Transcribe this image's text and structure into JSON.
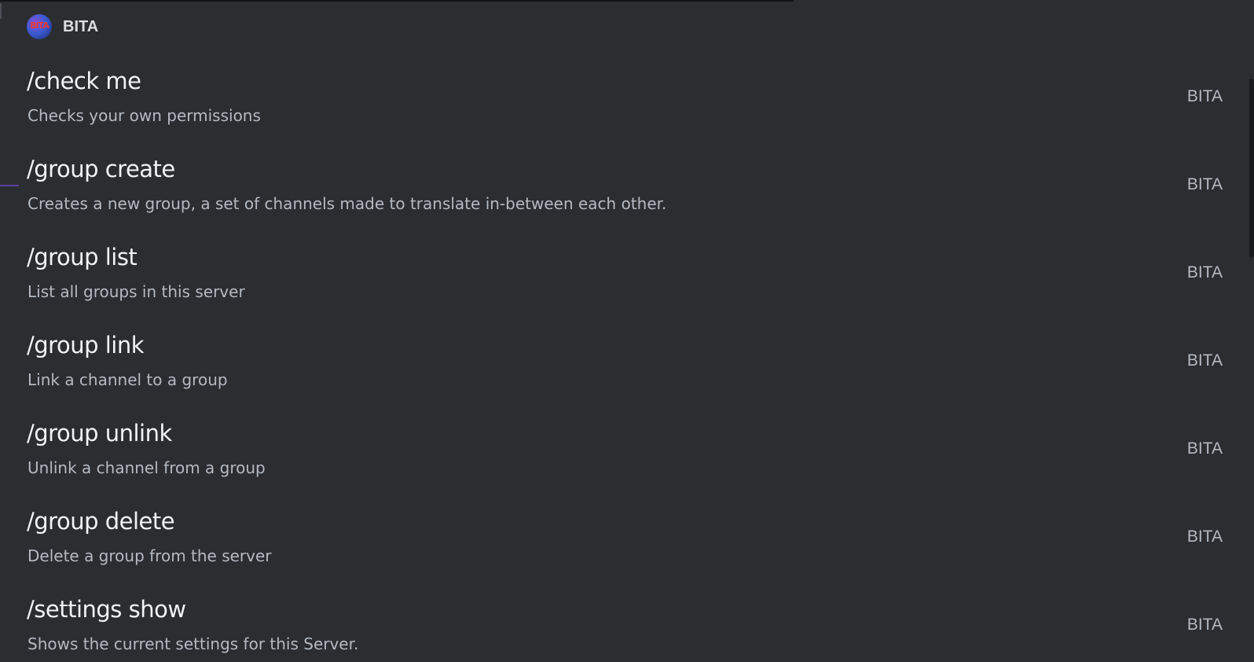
{
  "header": {
    "avatar_text": "BITA",
    "title": "BITA"
  },
  "commands": [
    {
      "name": "/check me",
      "description": "Checks your own permissions",
      "source": "BITA"
    },
    {
      "name": "/group create",
      "description": "Creates a new group, a set of channels made to translate in-between each other.",
      "source": "BITA"
    },
    {
      "name": "/group list",
      "description": "List all groups in this server",
      "source": "BITA"
    },
    {
      "name": "/group link",
      "description": "Link a channel to a group",
      "source": "BITA"
    },
    {
      "name": "/group unlink",
      "description": "Unlink a channel from a group",
      "source": "BITA"
    },
    {
      "name": "/group delete",
      "description": "Delete a group from the server",
      "source": "BITA"
    },
    {
      "name": "/settings show",
      "description": "Shows the current settings for this Server.",
      "source": "BITA"
    }
  ]
}
